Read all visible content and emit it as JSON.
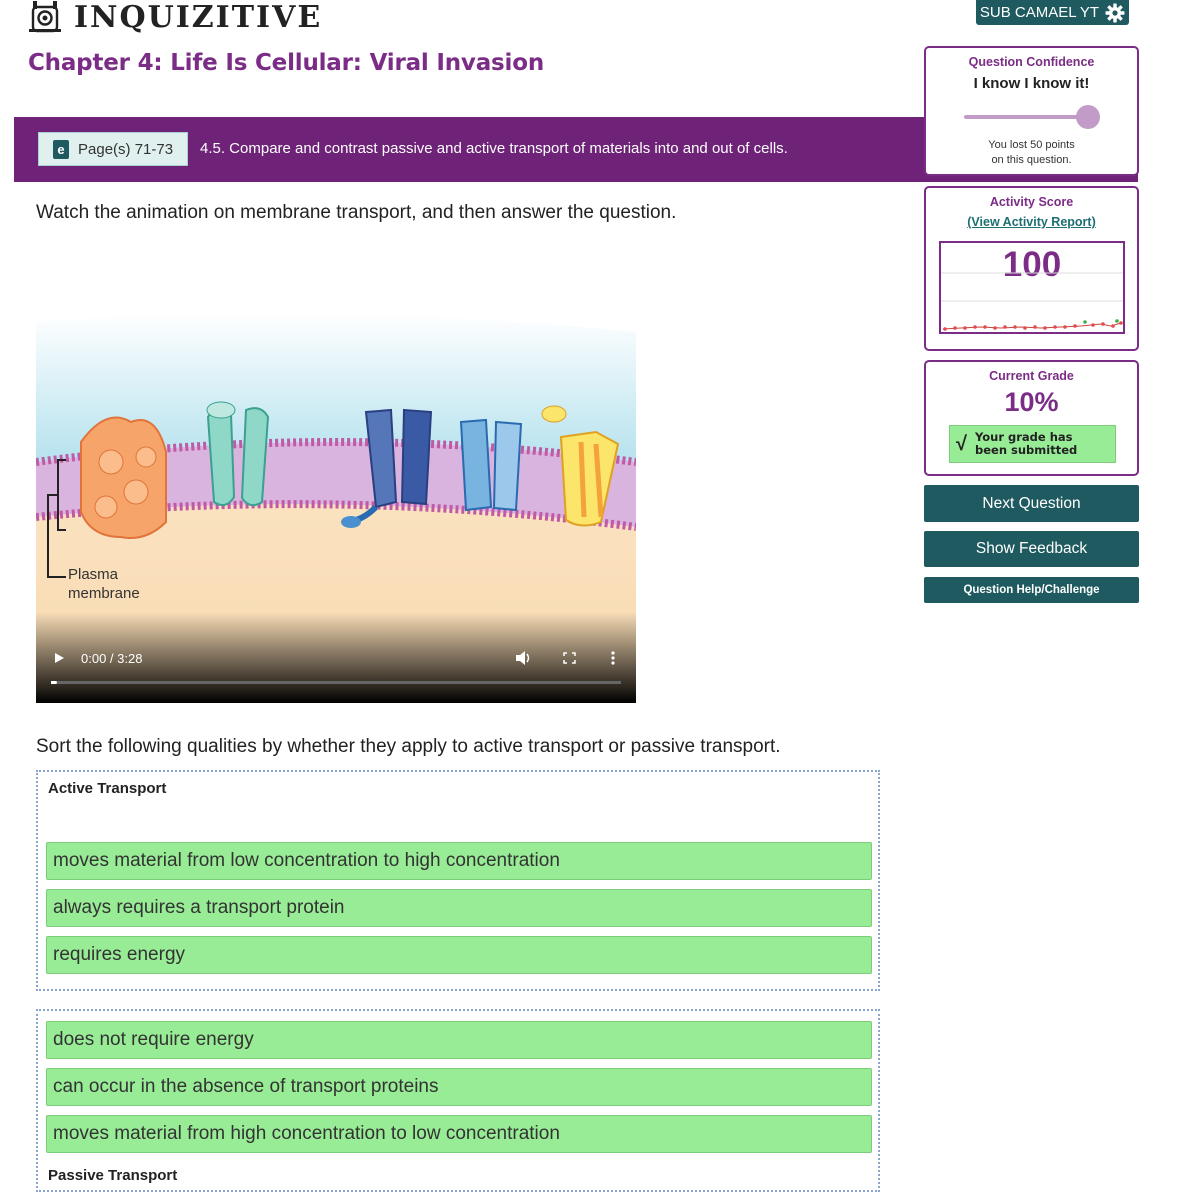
{
  "app": {
    "logo_text": "INQUIZITIVE",
    "user_button_label": "SUB CAMAEL YT"
  },
  "header": {
    "chapter_title": "Chapter 4: Life Is Cellular: Viral Invasion",
    "pages_label": "Page(s) 71-73",
    "ebook_icon_letter": "e",
    "objective": "4.5. Compare and contrast passive and active transport of materials into and out of cells."
  },
  "question": {
    "prompt": "Watch the animation on membrane transport, and then answer the question.",
    "video": {
      "diagram_label_line1": "Plasma",
      "diagram_label_line2": "membrane",
      "time": "0:00 / 3:28",
      "progress_fraction": 0.01
    },
    "sort_prompt": "Sort the following qualities by whether they apply to active transport or passive transport.",
    "active_zone": {
      "label": "Active Transport",
      "items": [
        "moves material from low concentration to high concentration",
        "always requires a transport protein",
        "requires energy"
      ]
    },
    "passive_zone": {
      "label": "Passive Transport",
      "items": [
        "does not require energy",
        "can occur in the absence of transport proteins",
        "moves material from high concentration to low concentration"
      ]
    }
  },
  "sidebar": {
    "confidence": {
      "title": "Question Confidence",
      "value": "I know I know it!",
      "note_line1": "You lost 50 points",
      "note_line2": "on this question."
    },
    "activity_score": {
      "title": "Activity Score",
      "report_link": "(View Activity Report)",
      "score": "100"
    },
    "grade": {
      "title": "Current Grade",
      "value": "10%",
      "submitted_line1": "Your grade has",
      "submitted_line2": "been submitted",
      "check_icon": "√"
    },
    "buttons": {
      "next": "Next Question",
      "feedback": "Show Feedback",
      "help": "Question Help/Challenge"
    }
  },
  "colors": {
    "brand_purple": "#7b2c86",
    "banner_purple": "#6f2378",
    "teal": "#1e5a5f",
    "card_green": "#98ec96"
  }
}
